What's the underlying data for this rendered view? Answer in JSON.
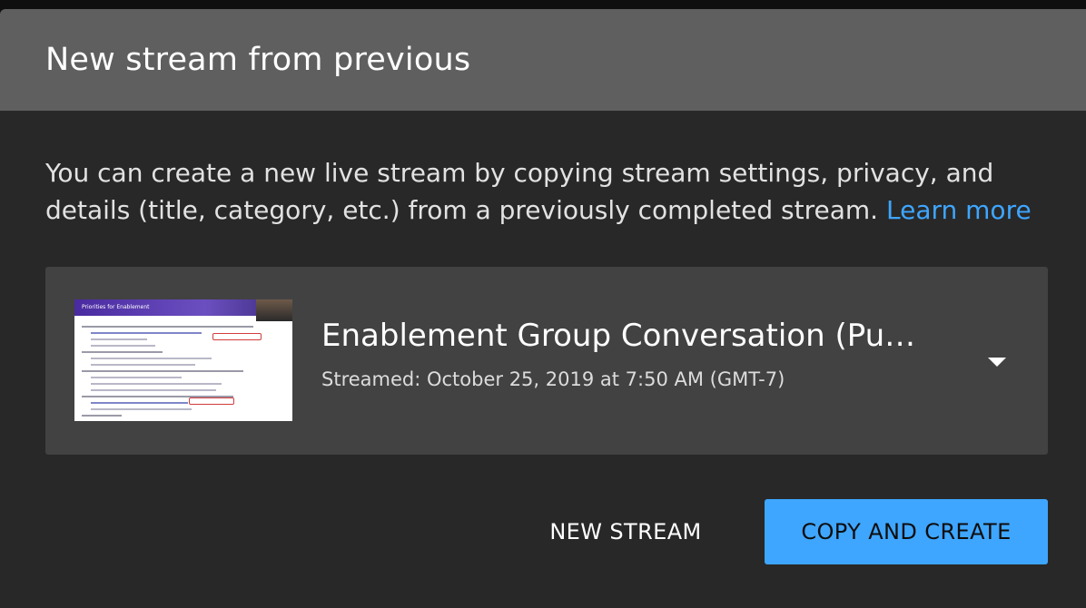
{
  "dialog": {
    "title": "New stream from previous",
    "description": "You can create a new live stream by copying stream settings, privacy, and details (title, category, etc.) from a previously completed stream.",
    "learn_more_label": "Learn more"
  },
  "selected_stream": {
    "title": "Enablement Group Conversation (Pu…",
    "streamed": "Streamed: October 25, 2019 at 7:50 AM (GMT-7)",
    "thumbnail_heading": "Priorities for Enablement"
  },
  "actions": {
    "new_stream_label": "NEW STREAM",
    "copy_create_label": "COPY AND CREATE"
  },
  "colors": {
    "accent": "#3ea6ff",
    "header_bg": "#5f5f5f",
    "dialog_bg": "#282828",
    "select_bg": "#424242"
  }
}
